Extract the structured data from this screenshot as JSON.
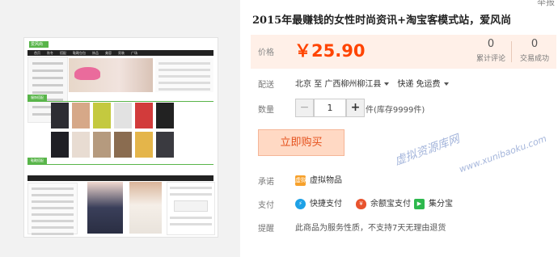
{
  "corner_link": "举报",
  "product": {
    "title": "2015年最赚钱的女性时尚资讯+淘宝客模式站，爱风尚"
  },
  "price": {
    "label": "价格",
    "currency": "￥",
    "value": "25.90"
  },
  "stats": [
    {
      "num": "0",
      "label": "累计评论"
    },
    {
      "num": "0",
      "label": "交易成功"
    }
  ],
  "delivery": {
    "label": "配送",
    "from": "北京",
    "to_word": "至",
    "destination": "广西柳州柳江县",
    "shipping": "快递 免运费"
  },
  "quantity": {
    "label": "数量",
    "minus": "−",
    "value": "1",
    "plus": "+",
    "stock_text": "件(库存9999件)"
  },
  "buy_button": "立即购买",
  "services": {
    "label": "承诺",
    "item": "虚拟物品",
    "icon_text": "虚拟"
  },
  "payment": {
    "label": "支付",
    "methods": [
      "快捷支付",
      "余额宝支付",
      "集分宝"
    ],
    "colors": [
      "#1da1e6",
      "#e8532d",
      "#2db84d"
    ]
  },
  "notice": {
    "label": "提醒",
    "text": "此商品为服务性质，不支持7天无理由退货"
  },
  "watermark": {
    "cn": "虚拟资源库网",
    "url": "www.xunibaoku.com"
  },
  "preview": {
    "logo": "爱风尚",
    "nav": [
      "首页",
      "秋冬",
      "搭配",
      "鞋靴包包",
      "饰品",
      "美容",
      "男装",
      "广场"
    ],
    "section1": "服饰搭配",
    "section2": "鞋靴搭配"
  }
}
